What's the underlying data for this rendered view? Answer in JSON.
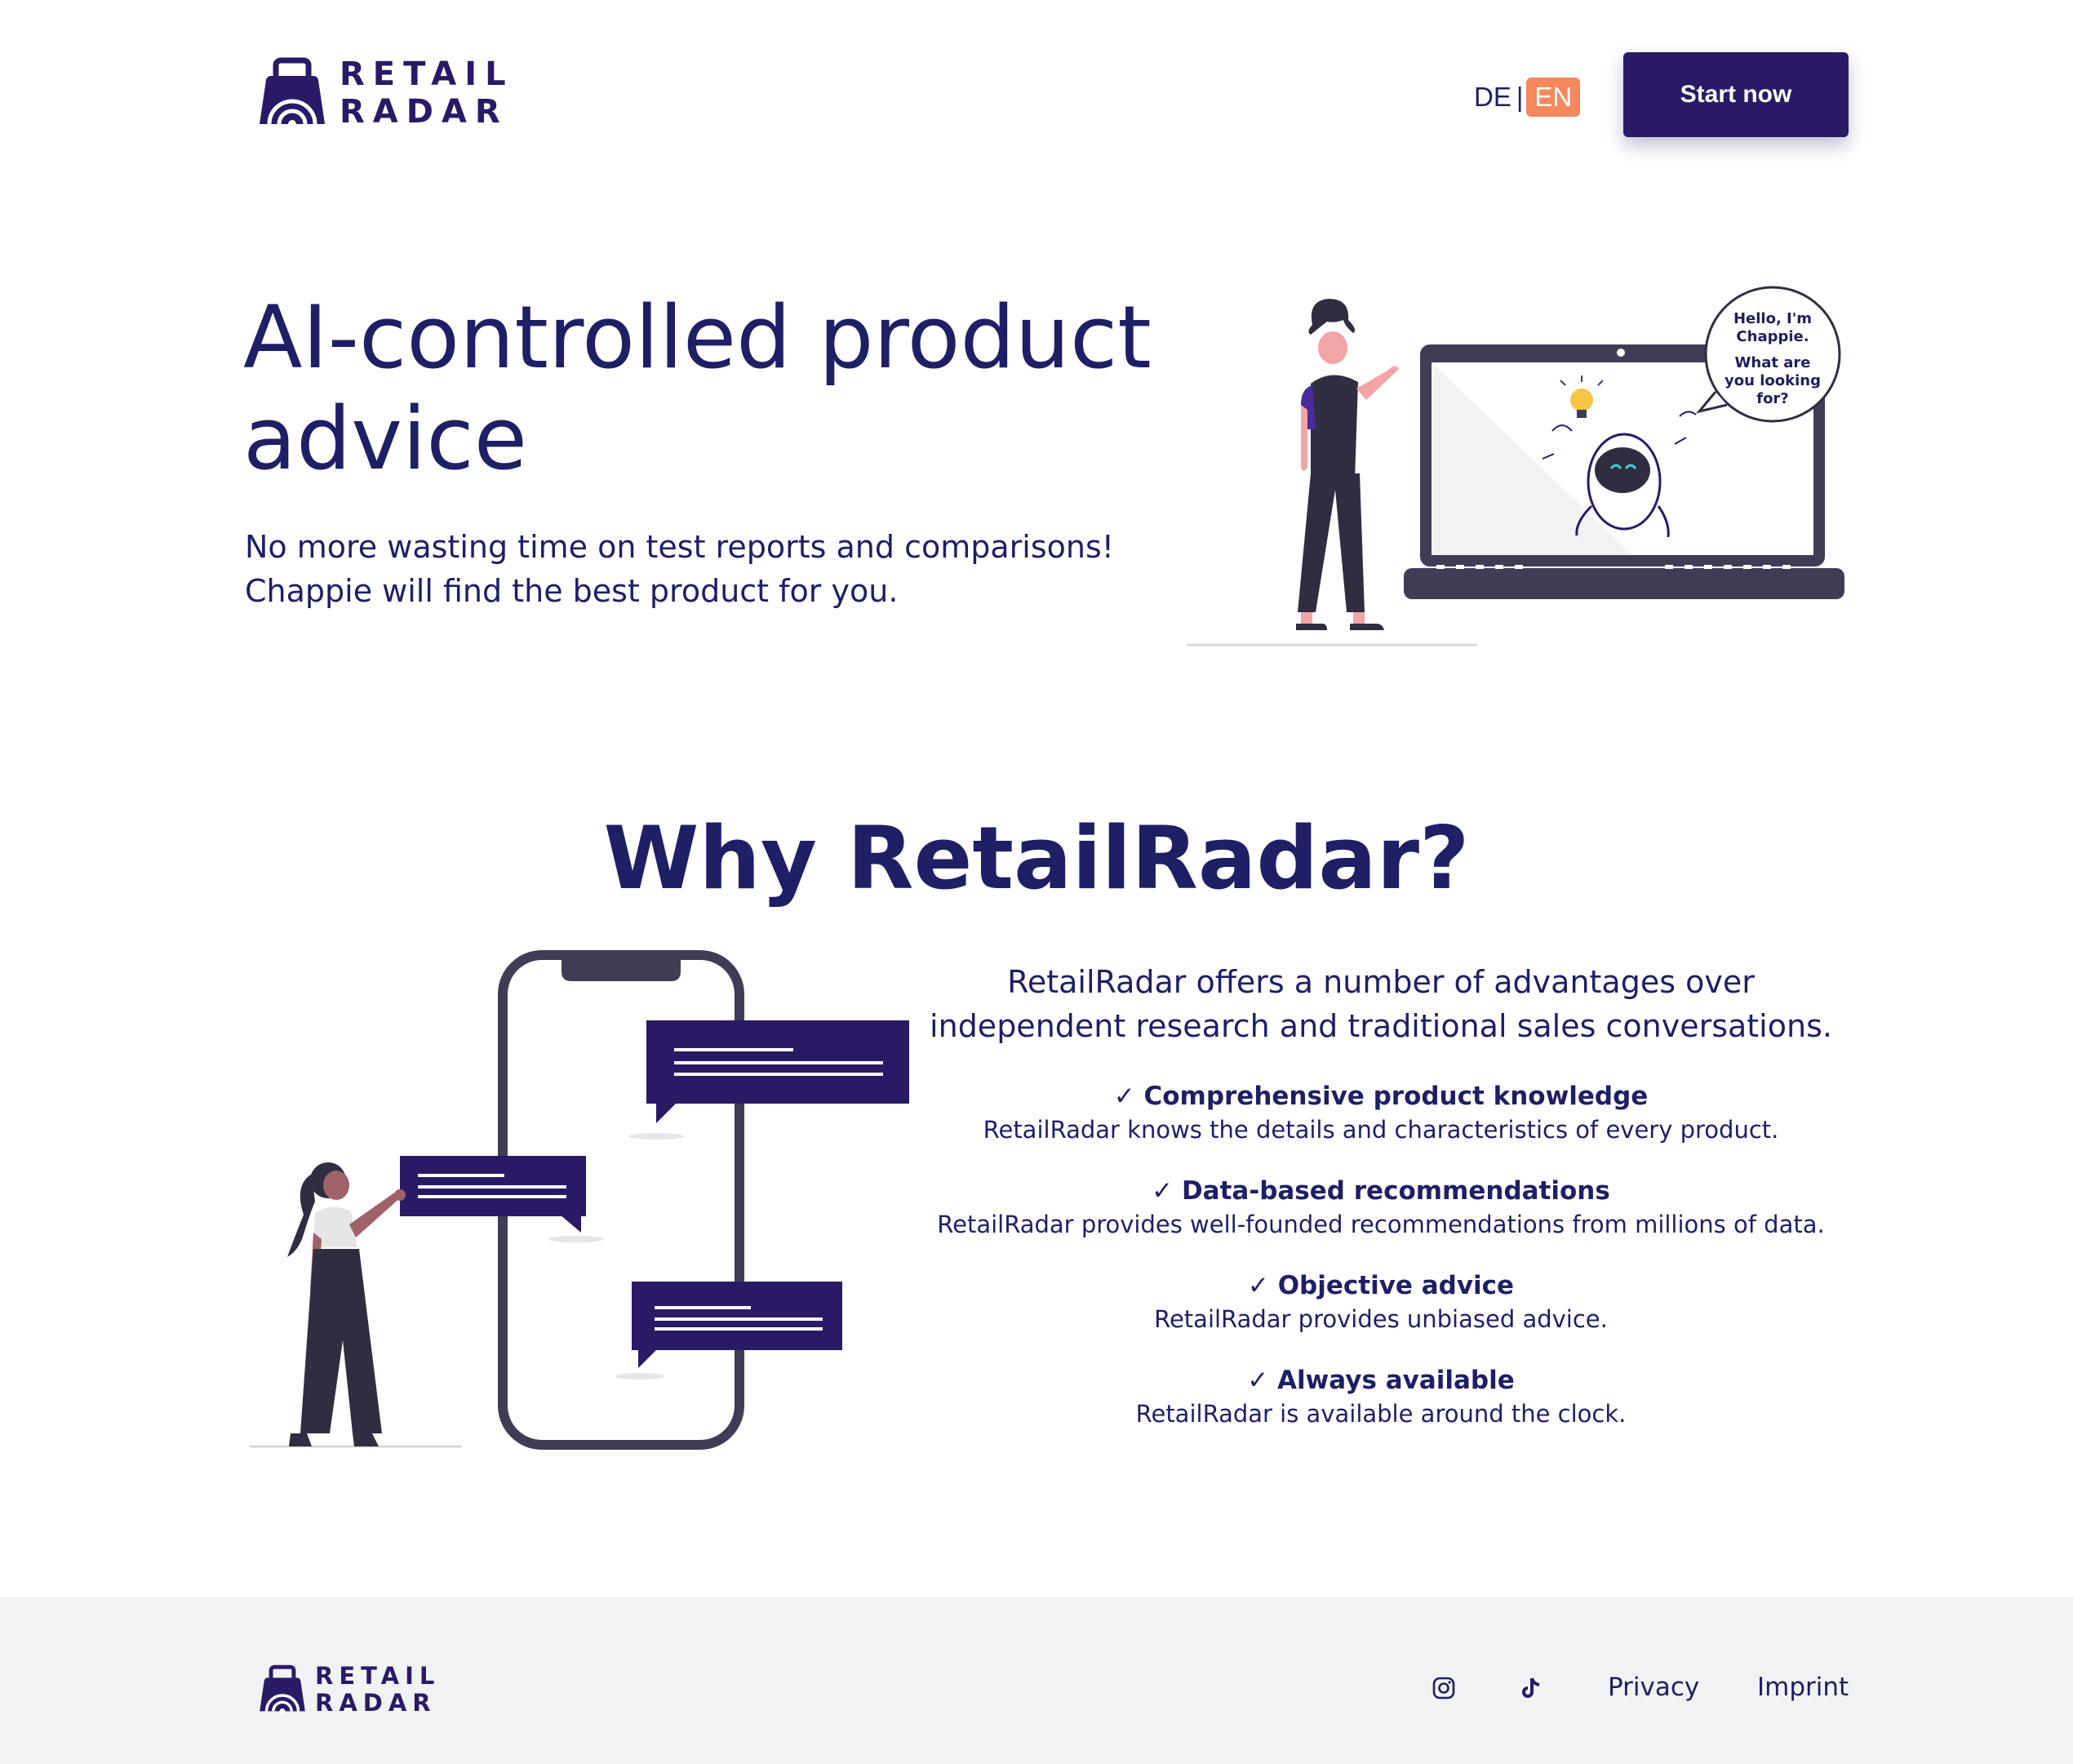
{
  "header": {
    "logo_line1": "RETAIL",
    "logo_line2": "RADAR",
    "lang_de": "DE",
    "lang_sep": "|",
    "lang_en": "EN",
    "cta_label": "Start now"
  },
  "hero": {
    "title_line1": "AI-controlled product",
    "title_line2": "advice",
    "subtitle_line1": "No more wasting time on test reports and comparisons!",
    "subtitle_line2": "Chappie will find the best product for you.",
    "bubble_line1": "Hello, I'm",
    "bubble_line2": "Chappie.",
    "bubble_line3": "What are",
    "bubble_line4": "you looking",
    "bubble_line5": "for?"
  },
  "why": {
    "title": "Why RetailRadar?",
    "intro_line1": "RetailRadar offers a number of advantages over",
    "intro_line2": "independent research and traditional sales conversations.",
    "advantages": [
      {
        "title": "✓ Comprehensive product knowledge",
        "desc": "RetailRadar knows the details and characteristics of every product."
      },
      {
        "title": "✓ Data-based recommendations",
        "desc": "RetailRadar provides well-founded recommendations from millions of data."
      },
      {
        "title": "✓ Objective advice",
        "desc": "RetailRadar provides unbiased advice."
      },
      {
        "title": "✓ Always available",
        "desc": "RetailRadar is available around the clock."
      }
    ]
  },
  "footer": {
    "logo_line1": "RETAIL",
    "logo_line2": "RADAR",
    "privacy": "Privacy",
    "imprint": "Imprint",
    "icons": [
      "instagram-icon",
      "tiktok-icon"
    ]
  },
  "colors": {
    "primary": "#2a1a66",
    "accent": "#f7875d",
    "text": "#1f1f66",
    "footer_bg": "#f1f2f4"
  }
}
